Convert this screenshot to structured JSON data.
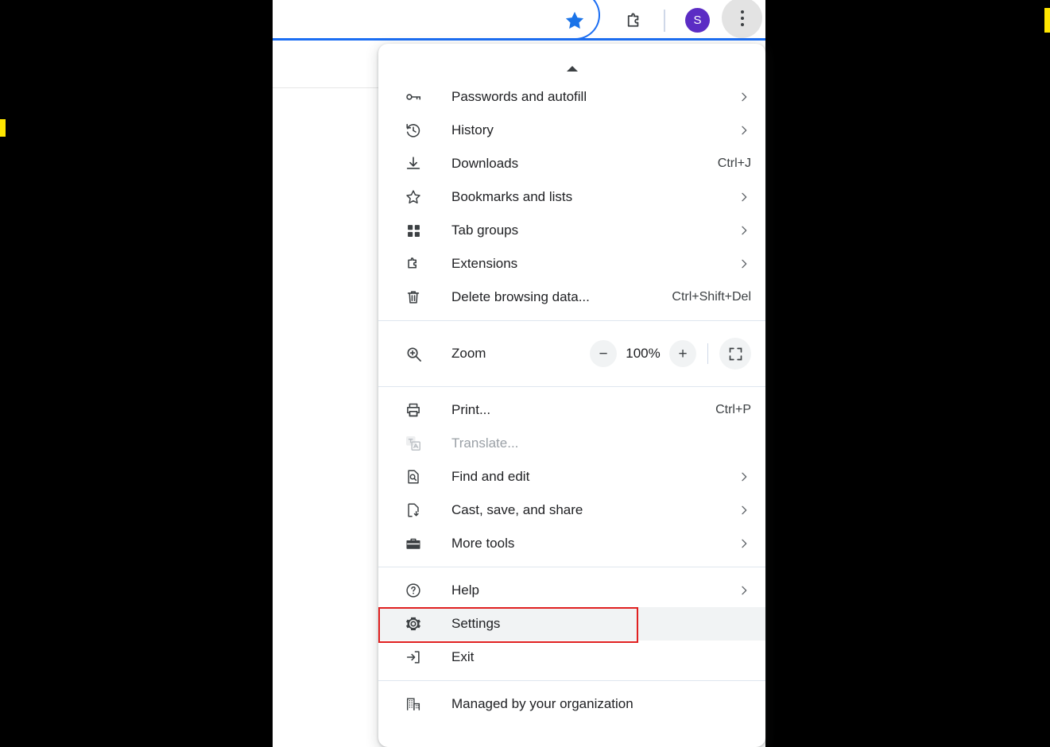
{
  "browser": {
    "toolbar": {
      "bookmark_star": "star-icon",
      "extensions_label": "Extensions",
      "avatar_initial": "S",
      "more_label": "Customize and control Google Chrome"
    },
    "accent_blue": "#1b6ef3",
    "avatar_color": "#5b2cc4",
    "annotation_color": "#e02020"
  },
  "menu": {
    "section1": [
      {
        "icon": "key-icon",
        "label": "Passwords and autofill",
        "accel": "",
        "arrow": true,
        "disabled": false
      },
      {
        "icon": "history-icon",
        "label": "History",
        "accel": "",
        "arrow": true,
        "disabled": false
      },
      {
        "icon": "download-icon",
        "label": "Downloads",
        "accel": "Ctrl+J",
        "arrow": false,
        "disabled": false
      },
      {
        "icon": "star-outline-icon",
        "label": "Bookmarks and lists",
        "accel": "",
        "arrow": true,
        "disabled": false
      },
      {
        "icon": "tab-groups-icon",
        "label": "Tab groups",
        "accel": "",
        "arrow": true,
        "disabled": false
      },
      {
        "icon": "puzzle-icon",
        "label": "Extensions",
        "accel": "",
        "arrow": true,
        "disabled": false
      },
      {
        "icon": "trash-icon",
        "label": "Delete browsing data...",
        "accel": "Ctrl+Shift+Del",
        "arrow": false,
        "disabled": false
      }
    ],
    "zoom": {
      "icon": "zoom-magnifier-icon",
      "label": "Zoom",
      "minus_label": "−",
      "level": "100%",
      "plus_label": "+",
      "fullscreen": "fullscreen-icon"
    },
    "section2": [
      {
        "icon": "printer-icon",
        "label": "Print...",
        "accel": "Ctrl+P",
        "arrow": false,
        "disabled": false
      },
      {
        "icon": "translate-icon",
        "label": "Translate...",
        "accel": "",
        "arrow": false,
        "disabled": true
      },
      {
        "icon": "find-edit-icon",
        "label": "Find and edit",
        "accel": "",
        "arrow": true,
        "disabled": false
      },
      {
        "icon": "cast-save-icon",
        "label": "Cast, save, and share",
        "accel": "",
        "arrow": true,
        "disabled": false
      },
      {
        "icon": "toolbox-icon",
        "label": "More tools",
        "accel": "",
        "arrow": true,
        "disabled": false
      }
    ],
    "section3": [
      {
        "icon": "help-icon",
        "label": "Help",
        "accel": "",
        "arrow": true,
        "disabled": false,
        "highlighted": false
      },
      {
        "icon": "gear-icon",
        "label": "Settings",
        "accel": "",
        "arrow": false,
        "disabled": false,
        "highlighted": true
      },
      {
        "icon": "exit-icon",
        "label": "Exit",
        "accel": "",
        "arrow": false,
        "disabled": false,
        "highlighted": false
      }
    ],
    "section4": [
      {
        "icon": "organization-icon",
        "label": "Managed by your organization",
        "accel": "",
        "arrow": false,
        "disabled": false
      }
    ]
  }
}
